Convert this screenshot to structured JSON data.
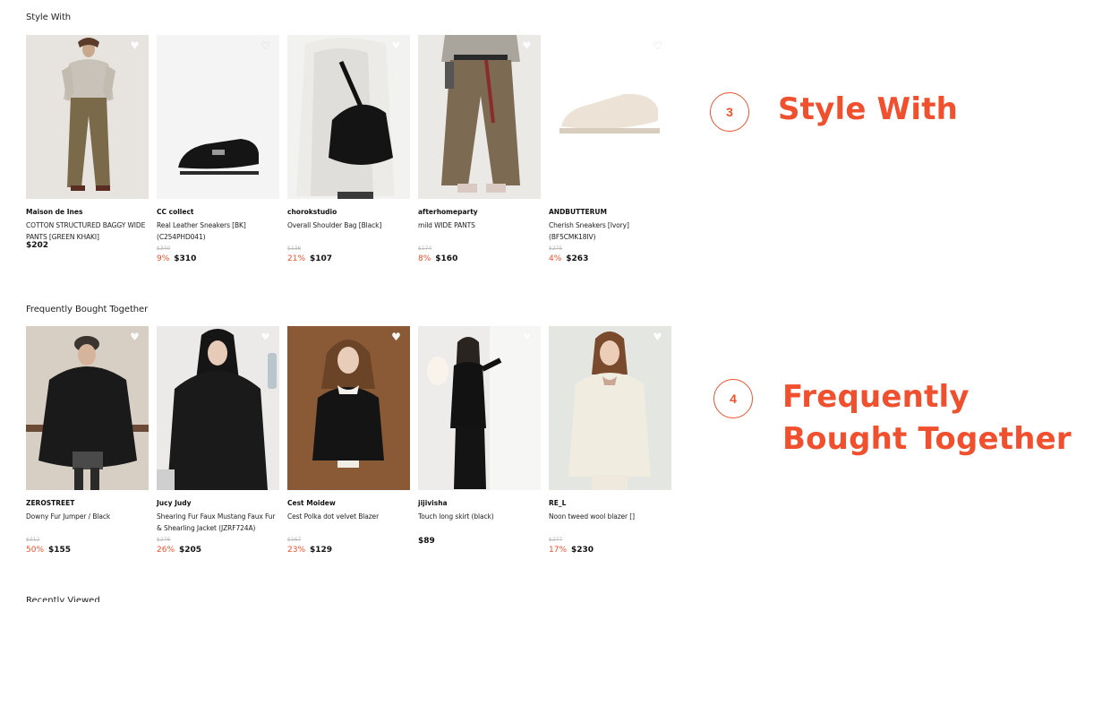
{
  "sections": [
    {
      "title": "Style With",
      "products": [
        {
          "brand": "Maison de Ines",
          "name": "COTTON STRUCTURED BAGGY WIDE PANTS [GREEN KHAKI]",
          "original_price": "",
          "discount": "",
          "price": "$202",
          "image": "model-khaki-pants"
        },
        {
          "brand": "CC collect",
          "name": "Real Leather Sneakers [BK] (C254PHD041)",
          "original_price": "$340",
          "discount": "9%",
          "price": "$310",
          "image": "black-sneaker"
        },
        {
          "brand": "chorokstudio",
          "name": "Overall Shoulder Bag [Black]",
          "original_price": "$136",
          "discount": "21%",
          "price": "$107",
          "image": "model-black-bag"
        },
        {
          "brand": "afterhomeparty",
          "name": "mild WIDE PANTS",
          "original_price": "$174",
          "discount": "8%",
          "price": "$160",
          "image": "model-wide-pants"
        },
        {
          "brand": "ANDBUTTERUM",
          "name": "Cherish Sneakers [Ivory] (BF5CMK18IV)",
          "original_price": "$275",
          "discount": "4%",
          "price": "$263",
          "image": "ivory-sneaker"
        }
      ]
    },
    {
      "title": "Frequently Bought Together",
      "products": [
        {
          "brand": "ZEROSTREET",
          "name": "Downy Fur Jumper / Black",
          "original_price": "$312",
          "discount": "50%",
          "price": "$155",
          "image": "model-fur-jumper"
        },
        {
          "brand": "Jucy Judy",
          "name": "Shearing Fur Faux Mustang Faux Fur & Shearling Jacket (JZRF724A)",
          "original_price": "$276",
          "discount": "26%",
          "price": "$205",
          "image": "model-shearling-jacket"
        },
        {
          "brand": "Cest Moidew",
          "name": "Cest Polka dot velvet Blazer",
          "original_price": "$167",
          "discount": "23%",
          "price": "$129",
          "image": "model-velvet-blazer"
        },
        {
          "brand": "jijivisha",
          "name": "Touch long skirt (black)",
          "original_price": "",
          "discount": "",
          "price": "$89",
          "image": "model-long-skirt"
        },
        {
          "brand": "RE_L",
          "name": "Noon tweed wool blazer []",
          "original_price": "$277",
          "discount": "17%",
          "price": "$230",
          "image": "model-tweed-blazer"
        }
      ]
    }
  ],
  "recently_viewed_title": "Recently Viewed",
  "callouts": [
    {
      "number": "3",
      "lines": [
        "Style With"
      ]
    },
    {
      "number": "4",
      "lines": [
        "Frequently",
        "Bought Together"
      ]
    }
  ],
  "colors": {
    "accent": "#f0502d",
    "text": "#111111",
    "muted": "#bdbdbd"
  },
  "icons": {
    "wishlist": "heart-icon"
  }
}
